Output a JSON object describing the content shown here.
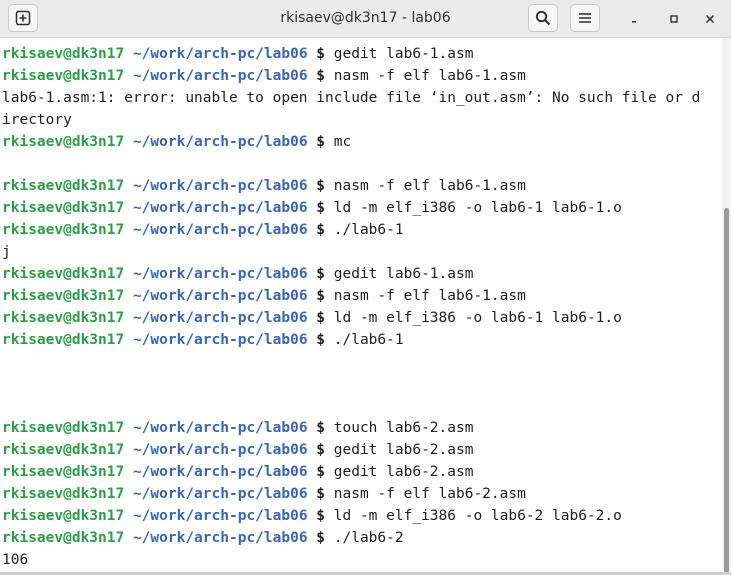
{
  "window": {
    "title": "rkisaev@dk3n17 - lab06",
    "buttons": {
      "new_tab_icon": "plus-in-square-icon",
      "search_icon": "search-icon",
      "menu_icon": "hamburger-menu-icon",
      "minimize_icon": "minimize-icon",
      "maximize_icon": "maximize-icon",
      "close_icon": "close-icon"
    }
  },
  "colors": {
    "prompt_user": "#2a9d4a",
    "prompt_path": "#3b63b8",
    "text": "#1e1e1e",
    "titlebar": "#ebebeb"
  },
  "prompt": {
    "user": "rkisaev@dk3n17",
    "path": "~/work/arch-pc/lab06",
    "symbol": "$"
  },
  "terminal": {
    "lines": [
      {
        "type": "prompt",
        "command": "gedit lab6-1.asm"
      },
      {
        "type": "prompt",
        "command": "nasm -f elf lab6-1.asm"
      },
      {
        "type": "output",
        "text": "lab6-1.asm:1: error: unable to open include file ‘in_out.asm’: No such file or d"
      },
      {
        "type": "output",
        "text": "irectory"
      },
      {
        "type": "prompt",
        "command": "mc"
      },
      {
        "type": "output",
        "text": ""
      },
      {
        "type": "prompt",
        "command": "nasm -f elf lab6-1.asm"
      },
      {
        "type": "prompt",
        "command": "ld -m elf_i386 -o lab6-1 lab6-1.o"
      },
      {
        "type": "prompt",
        "command": "./lab6-1"
      },
      {
        "type": "output",
        "text": "j"
      },
      {
        "type": "prompt",
        "command": "gedit lab6-1.asm"
      },
      {
        "type": "prompt",
        "command": "nasm -f elf lab6-1.asm"
      },
      {
        "type": "prompt",
        "command": "ld -m elf_i386 -o lab6-1 lab6-1.o"
      },
      {
        "type": "prompt",
        "command": "./lab6-1"
      },
      {
        "type": "output",
        "text": ""
      },
      {
        "type": "output",
        "text": ""
      },
      {
        "type": "output",
        "text": ""
      },
      {
        "type": "prompt",
        "command": "touch lab6-2.asm"
      },
      {
        "type": "prompt",
        "command": "gedit lab6-2.asm"
      },
      {
        "type": "prompt",
        "command": "gedit lab6-2.asm"
      },
      {
        "type": "prompt",
        "command": "nasm -f elf lab6-2.asm"
      },
      {
        "type": "prompt",
        "command": "ld -m elf_i386 -o lab6-2 lab6-2.o"
      },
      {
        "type": "prompt",
        "command": "./lab6-2"
      },
      {
        "type": "output",
        "text": "106"
      },
      {
        "type": "active_prompt",
        "command": ""
      }
    ]
  }
}
